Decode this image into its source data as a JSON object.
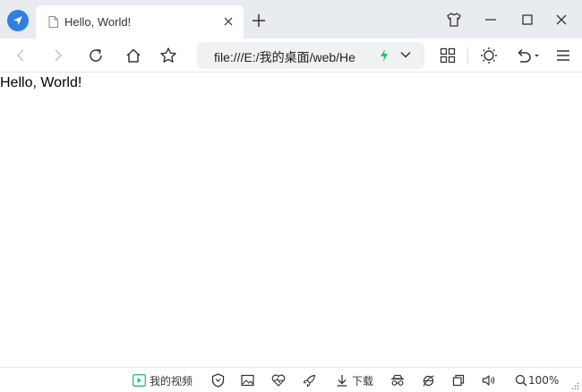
{
  "tab": {
    "title": "Hello, World!"
  },
  "address_bar": {
    "url": "file:///E:/我的桌面/web/He"
  },
  "page": {
    "text": "Hello, World!"
  },
  "statusbar": {
    "my_videos": "我的视频",
    "download": "下载",
    "zoom": "100%"
  },
  "icons": {
    "logo": "browser-logo-icon",
    "accent": "#2f7fe0",
    "bolt_color": "#2bbf6b"
  }
}
